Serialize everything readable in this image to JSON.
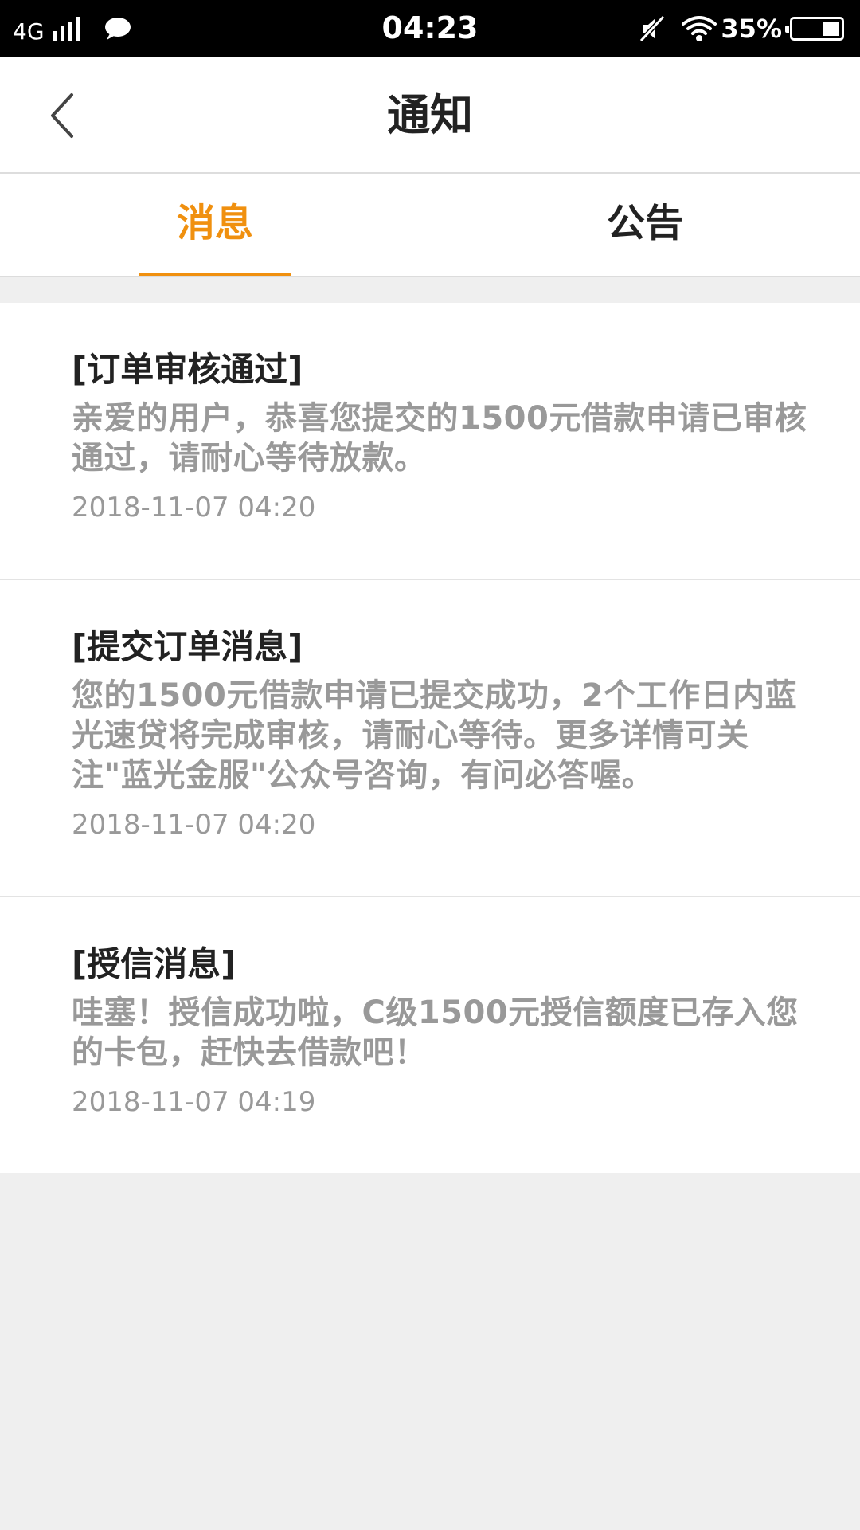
{
  "status_bar": {
    "network": "4G",
    "time": "04:23",
    "battery": "35%",
    "battery_level": 0.35,
    "icons": [
      "signal-icon",
      "chat-icon",
      "mute-icon",
      "wifi-icon",
      "battery-icon"
    ]
  },
  "nav": {
    "title": "通知",
    "back_icon": "chevron-left-icon"
  },
  "tabs": [
    {
      "label": "消息",
      "active": true
    },
    {
      "label": "公告",
      "active": false
    }
  ],
  "messages": [
    {
      "title": "[订单审核通过]",
      "body": "亲爱的用户，恭喜您提交的1500元借款申请已审核通过，请耐心等待放款。",
      "time": "2018-11-07 04:20"
    },
    {
      "title": "[提交订单消息]",
      "body": "您的1500元借款申请已提交成功，2个工作日内蓝光速贷将完成审核，请耐心等待。更多详情可关注\"蓝光金服\"公众号咨询，有问必答喔。",
      "time": "2018-11-07 04:20"
    },
    {
      "title": "[授信消息]",
      "body": "哇塞！授信成功啦，C级1500元授信额度已存入您的卡包，赶快去借款吧！",
      "time": "2018-11-07 04:19"
    }
  ],
  "colors": {
    "accent": "#f0900f",
    "text_dark": "#222222",
    "text_muted": "#999999",
    "background": "#efefef"
  }
}
